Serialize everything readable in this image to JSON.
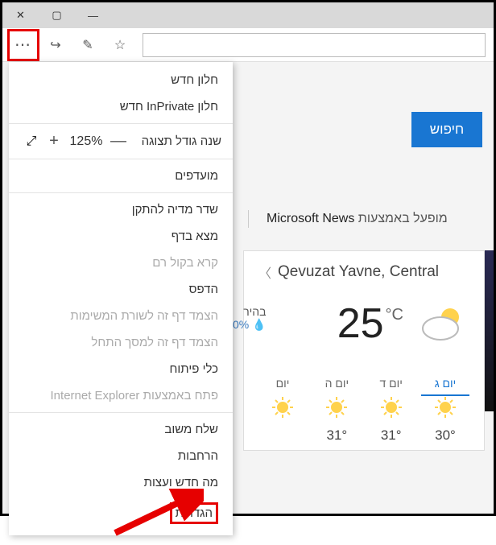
{
  "titlebar": {
    "close": "✕",
    "max": "▢",
    "min": "—"
  },
  "toolbar": {
    "more": "⋯",
    "share": "↪",
    "notes": "✎",
    "fav": "☆"
  },
  "menu": {
    "new_window": "חלון חדש",
    "new_inprivate": "חלון InPrivate חדש",
    "zoom_label": "שנה גודל תצוגה",
    "zoom_minus": "—",
    "zoom_val": "125%",
    "zoom_plus": "+",
    "fullscreen": "⤢",
    "favorites": "מועדפים",
    "cast": "שדר מדיה להתקן",
    "find": "מצא בדף",
    "read_aloud": "קרא בקול רם",
    "print": "הדפס",
    "pin_taskbar": "הצמד דף זה לשורת המשימות",
    "pin_start": "הצמד דף זה למסך התחל",
    "dev_tools": "כלי פיתוח",
    "open_ie": "פתח באמצעות Internet Explorer",
    "feedback": "שלח משוב",
    "extensions": "הרחבות",
    "whats_new": "מה חדש ועצות",
    "settings": "הגדרות"
  },
  "page": {
    "search_btn": "חיפוש",
    "powered_prefix": "מופעל באמצעות ",
    "powered_brand": "Microsoft News",
    "extra_label_1": "בהיר",
    "extra_label_2": "0%"
  },
  "weather": {
    "location": "Qevuzat Yavne, Central",
    "temp": "25",
    "unit": "°C",
    "days": [
      {
        "name": "יום ג",
        "temp": "30°"
      },
      {
        "name": "יום ד",
        "temp": "31°"
      },
      {
        "name": "יום ה",
        "temp": "31°"
      },
      {
        "name": "יום",
        "temp": ""
      }
    ]
  }
}
